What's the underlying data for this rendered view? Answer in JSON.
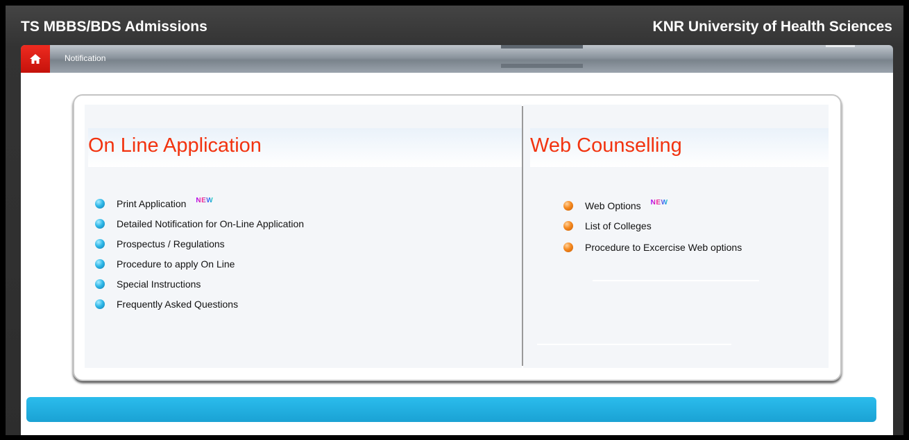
{
  "header": {
    "left_title": "TS MBBS/BDS Admissions",
    "right_title": "KNR University of Health Sciences"
  },
  "nav": {
    "home_icon": "home-icon",
    "label": "Notification"
  },
  "online_application": {
    "title": "On Line Application",
    "items": [
      {
        "label": "Print Application",
        "badge": "NEW"
      },
      {
        "label": "Detailed Notification for On-Line Application"
      },
      {
        "label": "Prospectus / Regulations"
      },
      {
        "label": "Procedure to apply On Line"
      },
      {
        "label": "Special Instructions"
      },
      {
        "label": "Frequently Asked Questions"
      }
    ]
  },
  "web_counselling": {
    "title": "Web Counselling",
    "items": [
      {
        "label": "Web Options",
        "badge": "NEW"
      },
      {
        "label": "List of Colleges"
      },
      {
        "label": "Procedure to Excercise Web options"
      }
    ]
  },
  "colors": {
    "title_red": "#f2330f",
    "home_red": "#e2221a",
    "bottom_bar_blue": "#1fb0e2",
    "bullet_blue": "#31b9e9",
    "bullet_orange": "#f5891f"
  }
}
